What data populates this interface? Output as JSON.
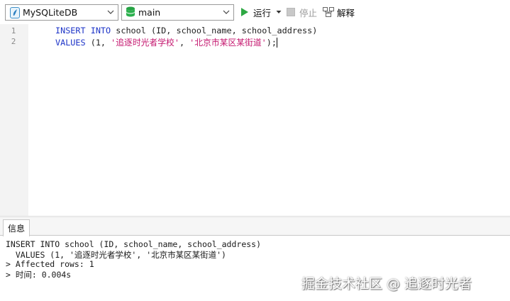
{
  "toolbar": {
    "connection": {
      "value": "MySQLiteDB",
      "icon": "connection-icon"
    },
    "database": {
      "value": "main",
      "icon": "database-icon"
    },
    "run_label": "运行",
    "stop_label": "停止",
    "explain_label": "解释"
  },
  "editor": {
    "lines": [
      {
        "number": "1",
        "keyword1": "INSERT INTO",
        "text1": " school (ID, school_name, school_address)"
      },
      {
        "number": "2",
        "keyword1": "VALUES",
        "text1": " (1, ",
        "string1": "'追逐时光者学校'",
        "text2": ", ",
        "string2": "'北京市某区某街道'",
        "text3": ");"
      }
    ]
  },
  "result_panel": {
    "tab_label": "信息",
    "lines": [
      "INSERT INTO school (ID, school_name, school_address)",
      "  VALUES (1, '追逐时光者学校', '北京市某区某街道')",
      "> Affected rows: 1",
      "> 时间: 0.004s"
    ]
  },
  "watermark": "掘金技术社区 @ 追逐时光者",
  "colors": {
    "keyword": "#1e35c8",
    "string": "#c4166e",
    "run_green": "#2ea843",
    "db_green": "#25a244"
  }
}
